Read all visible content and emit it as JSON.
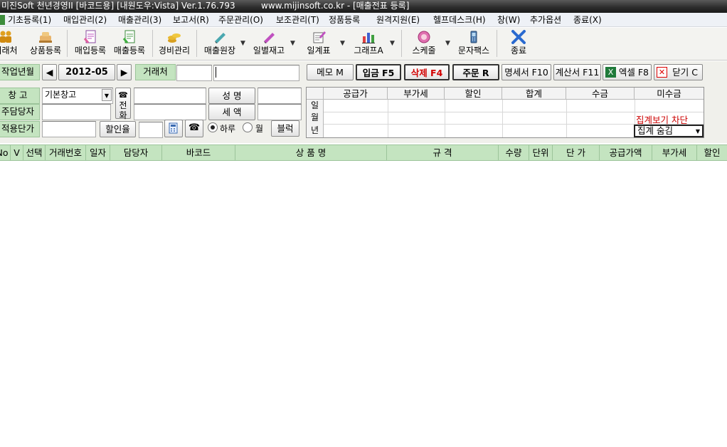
{
  "window": {
    "title": "미진Soft 천년경영II [바코드용] [내원도우:Vista] Ver.1.76.793",
    "url_title": "www.mijinsoft.co.kr - [매출전표 등록]"
  },
  "menu": [
    {
      "label": "기초등록(1)"
    },
    {
      "label": "매입관리(2)"
    },
    {
      "label": "매출관리(3)"
    },
    {
      "label": "보고서(R)"
    },
    {
      "label": "주문관리(O)"
    },
    {
      "label": "보조관리(T)"
    },
    {
      "label": "정품등록"
    },
    {
      "label": "원격지원(E)"
    },
    {
      "label": "헬프데스크(H)"
    },
    {
      "label": "창(W)"
    },
    {
      "label": "추가옵션"
    },
    {
      "label": "종료(X)"
    }
  ],
  "toolbar": {
    "buttons": [
      {
        "label": "거래처",
        "icon": "people-icon"
      },
      {
        "label": "상품등록",
        "icon": "product-icon"
      },
      {
        "label": "매입등록",
        "icon": "purchase-icon"
      },
      {
        "label": "매출등록",
        "icon": "sales-icon"
      },
      {
        "label": "경비관리",
        "icon": "coins-icon"
      },
      {
        "label": "매출원장",
        "icon": "ledger-icon"
      },
      {
        "label": "일별재고",
        "icon": "inventory-icon"
      },
      {
        "label": "일계표",
        "icon": "daily-report-icon"
      },
      {
        "label": "그래프A",
        "icon": "bar-chart-icon"
      },
      {
        "label": "스케줄",
        "icon": "schedule-icon"
      },
      {
        "label": "문자팩스",
        "icon": "phone-fax-icon"
      },
      {
        "label": "종료",
        "icon": "exit-x-icon"
      }
    ]
  },
  "form": {
    "work_month_label": "작업년월",
    "work_month_value": "2012-05",
    "client_label": "거래처",
    "warehouse_label": "창      고",
    "warehouse_value": "기본창고",
    "manager_label": "주담당자",
    "unit_price_label": "적용단가",
    "phone_label": "전화",
    "name_label": "성  명",
    "tax_label": "세  액",
    "discount_rate_label": "할인율",
    "radio_day": "하루",
    "radio_month": "월",
    "block_button": "블럭"
  },
  "actions": {
    "memo": "메모 M",
    "deposit": "입금 F5",
    "delete": "삭제 F4",
    "order": "주문 R",
    "statement": "명세서 F10",
    "invoice": "계산서 F11",
    "excel": "엑셀 F8",
    "close": "닫기 C"
  },
  "summary": {
    "columns": [
      "공급가",
      "부가세",
      "할인",
      "합계",
      "수금",
      "미수금"
    ],
    "rows": [
      "일",
      "월",
      "년"
    ],
    "link_text": "집계보기 차단",
    "select_value": "집계 숨김"
  },
  "grid": {
    "columns": [
      "No",
      "V",
      "선택",
      "거래번호",
      "일자",
      "담당자",
      "바코드",
      "상 품 명",
      "규 격",
      "수량",
      "단위",
      "단 가",
      "공급가액",
      "부가세",
      "할인"
    ]
  },
  "colors": {
    "label_green": "#c4e4c0",
    "delete_red": "#d20000",
    "link_red": "#cc0000"
  }
}
